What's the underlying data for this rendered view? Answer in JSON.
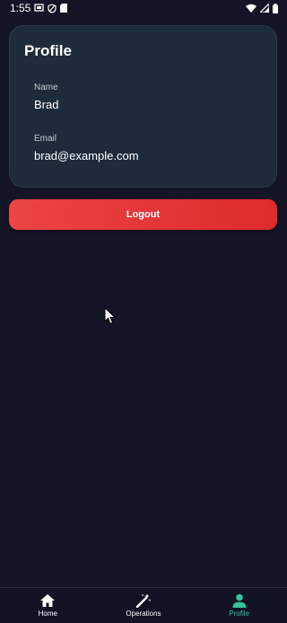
{
  "status_bar": {
    "time": "1:55",
    "icons": [
      "screen-icon",
      "shield-icon",
      "sim-card-icon",
      "wifi-icon",
      "signal-icon",
      "battery-icon"
    ]
  },
  "profile": {
    "title": "Profile",
    "name_label": "Name",
    "name_value": "Brad",
    "email_label": "Email",
    "email_value": "brad@example.com"
  },
  "logout_label": "Logout",
  "nav": {
    "items": [
      {
        "label": "Home",
        "icon": "home-icon",
        "active": false
      },
      {
        "label": "Operations",
        "icon": "magic-wand-icon",
        "active": false
      },
      {
        "label": "Profile",
        "icon": "person-icon",
        "active": true
      }
    ]
  },
  "colors": {
    "background": "#131426",
    "card": "#1e2b3a",
    "logout": "#e53535",
    "active_nav": "#34c39a"
  }
}
